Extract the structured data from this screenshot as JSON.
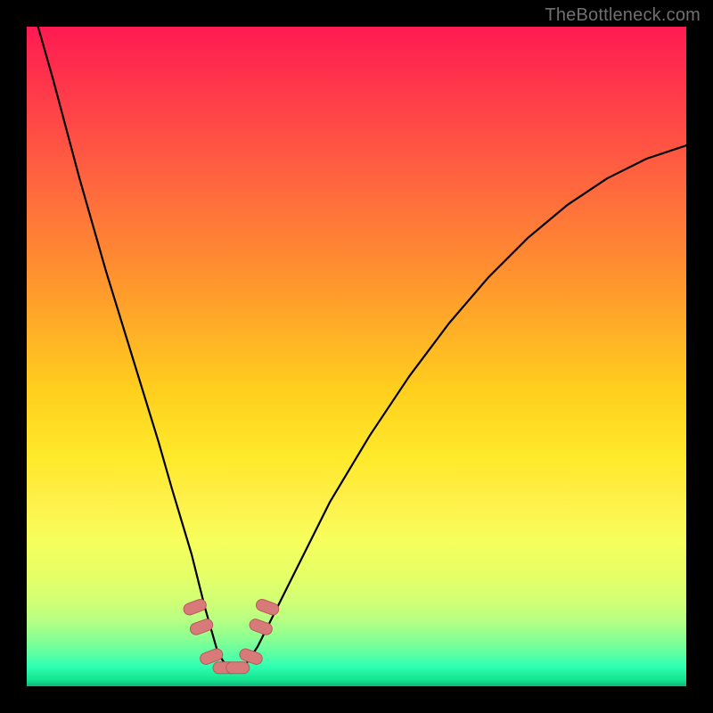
{
  "watermark": "TheBottleneck.com",
  "colors": {
    "frame_bg": "#000000",
    "curve_stroke": "#000000",
    "marker_fill": "#d97a7a",
    "marker_stroke": "#b85a5a",
    "gradient_top": "#ff1a52",
    "gradient_mid": "#ffe92a",
    "gradient_bottom": "#0db57a"
  },
  "chart_data": {
    "type": "line",
    "title": "",
    "xlabel": "",
    "ylabel": "",
    "xlim": [
      0,
      100
    ],
    "ylim": [
      0,
      100
    ],
    "notch_x": 31,
    "series": [
      {
        "name": "bottleneck-curve",
        "x": [
          0,
          4,
          8,
          12,
          16,
          20,
          22,
          25,
          27,
          29,
          31,
          33,
          35,
          38,
          42,
          46,
          52,
          58,
          64,
          70,
          76,
          82,
          88,
          94,
          100
        ],
        "y": [
          106,
          92,
          77,
          63,
          50,
          37,
          30,
          20,
          12,
          5,
          2,
          3,
          6,
          12,
          20,
          28,
          38,
          47,
          55,
          62,
          68,
          73,
          77,
          80,
          82
        ]
      }
    ],
    "markers": [
      {
        "x": 25.5,
        "y": 12.0
      },
      {
        "x": 26.5,
        "y": 9.0
      },
      {
        "x": 28.0,
        "y": 4.5
      },
      {
        "x": 30.0,
        "y": 2.8
      },
      {
        "x": 32.0,
        "y": 2.8
      },
      {
        "x": 34.0,
        "y": 4.5
      },
      {
        "x": 35.5,
        "y": 9.0
      },
      {
        "x": 36.5,
        "y": 12.0
      }
    ]
  }
}
